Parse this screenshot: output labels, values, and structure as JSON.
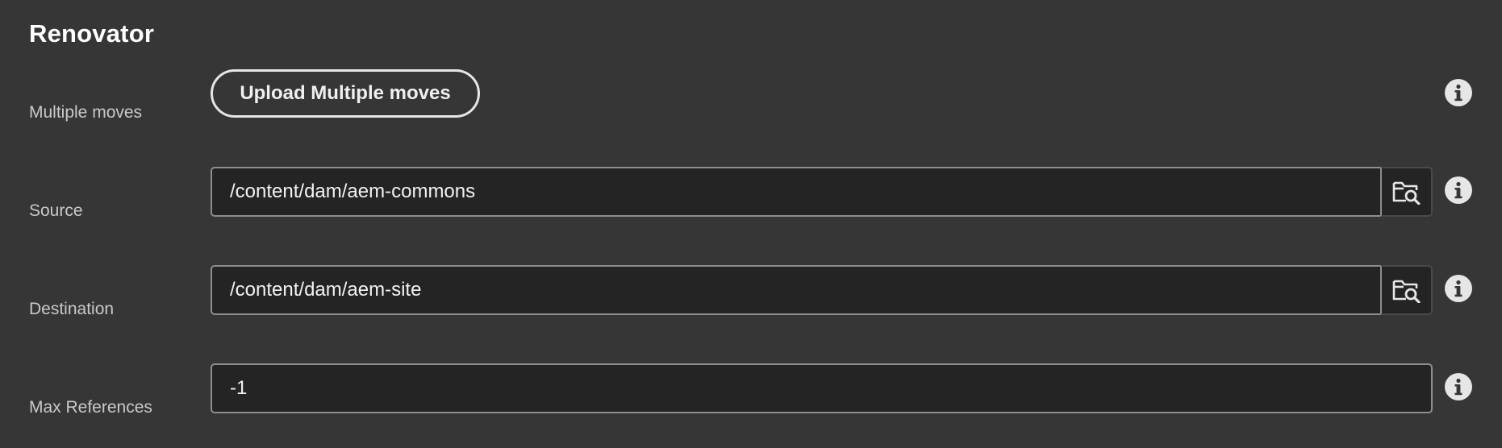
{
  "section": {
    "title": "Renovator"
  },
  "fields": {
    "multiple_moves": {
      "label": "Multiple moves",
      "button_label": "Upload Multiple moves"
    },
    "source": {
      "label": "Source",
      "value": "/content/dam/aem-commons"
    },
    "destination": {
      "label": "Destination",
      "value": "/content/dam/aem-site"
    },
    "max_references": {
      "label": "Max References",
      "value": "-1"
    }
  },
  "icons": {
    "info": "info-icon",
    "browse": "folder-search-icon"
  },
  "colors": {
    "background": "#363636",
    "field_background": "#242424",
    "field_border": "#8e8e8e",
    "text": "#f2f2f2",
    "label": "#c9c9c9"
  }
}
